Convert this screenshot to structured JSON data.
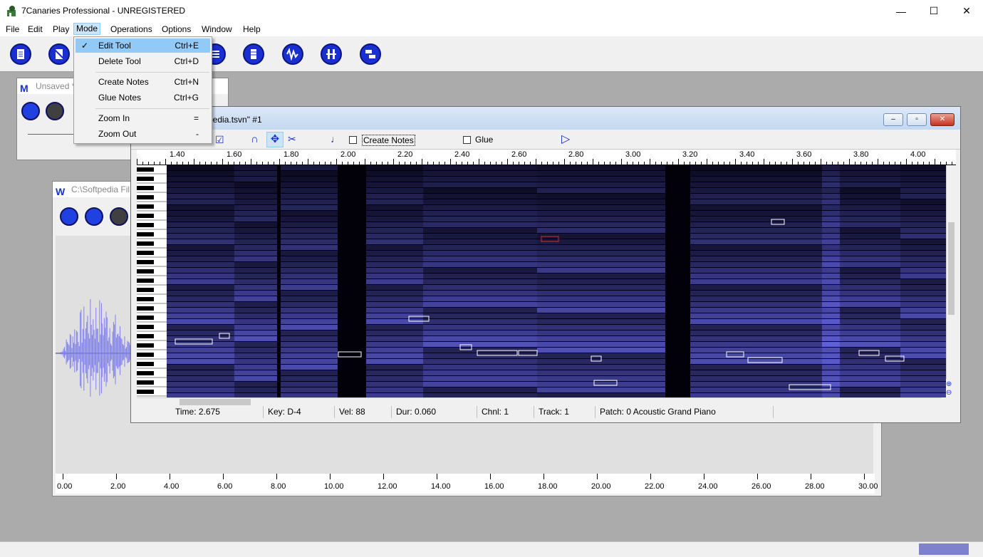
{
  "app": {
    "title": "7Canaries Professional - UNREGISTERED",
    "controls": {
      "minimize": "—",
      "maximize": "☐",
      "close": "✕"
    }
  },
  "menubar": {
    "items": [
      "File",
      "Edit",
      "Play",
      "Mode",
      "Operations",
      "Options",
      "Window",
      "Help"
    ],
    "active": "Mode"
  },
  "toolbar": {
    "buttons": [
      "new-document-icon",
      "no-document-icon",
      "list-icon",
      "list-alt-icon",
      "waveform-icon",
      "split-icon",
      "stack-icon"
    ]
  },
  "mode_menu": {
    "items": [
      {
        "label": "Edit Tool",
        "shortcut": "Ctrl+E",
        "checked": true
      },
      {
        "label": "Delete Tool",
        "shortcut": "Ctrl+D",
        "checked": false
      },
      {
        "label": "Create Notes",
        "shortcut": "Ctrl+N",
        "checked": false
      },
      {
        "label": "Glue Notes",
        "shortcut": "Ctrl+G",
        "checked": false
      },
      {
        "label": "Zoom In",
        "shortcut": "=",
        "checked": false
      },
      {
        "label": "Zoom Out",
        "shortcut": "-",
        "checked": false
      }
    ]
  },
  "unsaved_window": {
    "title": "Unsaved *1"
  },
  "wave_window": {
    "title": "C:\\Softpedia Fil",
    "ruler": [
      "0.00",
      "2.00",
      "4.00",
      "6.00",
      "8.00",
      "10.00",
      "12.00",
      "14.00",
      "16.00",
      "18.00",
      "20.00",
      "22.00",
      "24.00",
      "26.00",
      "28.00",
      "30.00"
    ]
  },
  "pianoroll_window": {
    "title": "pedia.tsvn\" #1",
    "create_notes_label": "Create Notes",
    "glue_label": "Glue",
    "ruler": [
      "1.40",
      "1.60",
      "1.80",
      "2.00",
      "2.20",
      "2.40",
      "2.60",
      "2.80",
      "3.00",
      "3.20",
      "3.40",
      "3.60",
      "3.80",
      "4.00"
    ],
    "status": {
      "time": "Time: 2.675",
      "key": "Key: D-4",
      "vel": "Vel: 88",
      "dur": "Dur: 0.060",
      "chnl": "Chnl: 1",
      "track": "Track: 1",
      "patch": "Patch: 0 Acoustic Grand Piano"
    }
  },
  "colors": {
    "accent": "#1a2fd0",
    "spectrogram": "#6a6af0",
    "wave": "#8080e8"
  }
}
